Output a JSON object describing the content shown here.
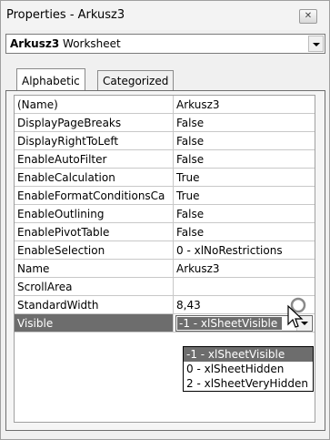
{
  "window": {
    "title": "Properties - Arkusz3",
    "close_icon": "close-x-icon"
  },
  "object_selector": {
    "name": "Arkusz3",
    "type": "Worksheet"
  },
  "tabs": [
    {
      "label": "Alphabetic",
      "active": true
    },
    {
      "label": "Categorized",
      "active": false
    }
  ],
  "properties": [
    {
      "name": "(Name)",
      "value": "Arkusz3"
    },
    {
      "name": "DisplayPageBreaks",
      "value": "False"
    },
    {
      "name": "DisplayRightToLeft",
      "value": "False"
    },
    {
      "name": "EnableAutoFilter",
      "value": "False"
    },
    {
      "name": "EnableCalculation",
      "value": "True"
    },
    {
      "name": "EnableFormatConditionsCa",
      "value": "True"
    },
    {
      "name": "EnableOutlining",
      "value": "False"
    },
    {
      "name": "EnablePivotTable",
      "value": "False"
    },
    {
      "name": "EnableSelection",
      "value": "0 - xlNoRestrictions"
    },
    {
      "name": "Name",
      "value": "Arkusz3"
    },
    {
      "name": "ScrollArea",
      "value": ""
    },
    {
      "name": "StandardWidth",
      "value": "8,43"
    },
    {
      "name": "Visible",
      "value": "-1 - xlSheetVisible"
    }
  ],
  "dropdown_options": [
    {
      "label": "-1 - xlSheetVisible",
      "highlighted": true
    },
    {
      "label": "0 - xlSheetHidden",
      "highlighted": false
    },
    {
      "label": "2 - xlSheetVeryHidden",
      "highlighted": false
    }
  ],
  "colors": {
    "selection": "#6d6d6d",
    "window_bg": "#f0f0f0"
  }
}
